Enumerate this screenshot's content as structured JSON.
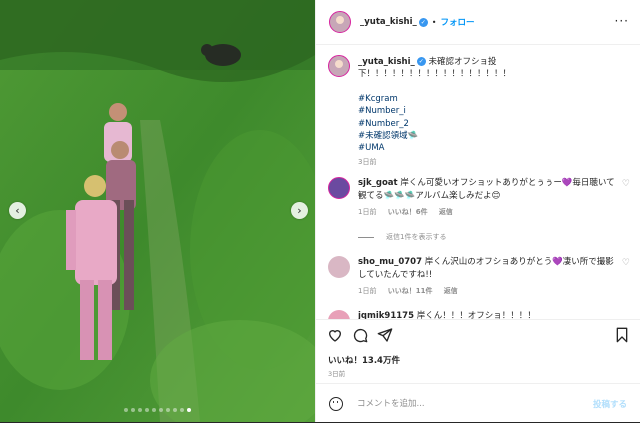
{
  "header": {
    "username": "_yuta_kishi_",
    "verified_mark": "✓",
    "separator": "•",
    "follow_label": "フォロー",
    "more_label": "···"
  },
  "caption": {
    "username": "_yuta_kishi_",
    "text": "未確認オフショ投下！！！！！！！！！！！！！！！！！",
    "hashtags": [
      "#Kcgram",
      "#Number_i",
      "#Number_2",
      "#未確認領域🛸",
      "#UMA"
    ],
    "time": "3日前"
  },
  "comments": [
    {
      "username": "sjk_goat",
      "text": "岸くん可愛いオフショットありがとぅぅー💜毎日聴いて観てる🛸🛸🛸アルバム楽しみだよ😊",
      "time": "1日前",
      "likes": "いいね！6件",
      "reply": "返信"
    },
    {
      "username": "sho_mu_0707",
      "text": "岸くん沢山のオフショありがとう💜凄い所で撮影していたんですね!!",
      "time": "1日前",
      "likes": "いいね！11件",
      "reply": "返信"
    },
    {
      "username": "jqmik91175",
      "text": "岸くん！！！オフショ！！！！",
      "time": "",
      "likes": "",
      "reply": ""
    }
  ],
  "view_replies": "返信1件を表示する",
  "actions": {
    "likes": "いいね！13.4万件",
    "date": "3日前"
  },
  "add_comment": {
    "placeholder": "コメントを追加...",
    "post_label": "投稿する"
  },
  "media": {
    "prev_arrow": "‹",
    "next_arrow": "›",
    "slide_count": 10,
    "active_slide": 9
  },
  "colors": {
    "link": "#00376b",
    "follow": "#0095f6",
    "post_disabled": "#b2dffc",
    "muted": "#8e8e8e",
    "verified": "#3897f0"
  }
}
